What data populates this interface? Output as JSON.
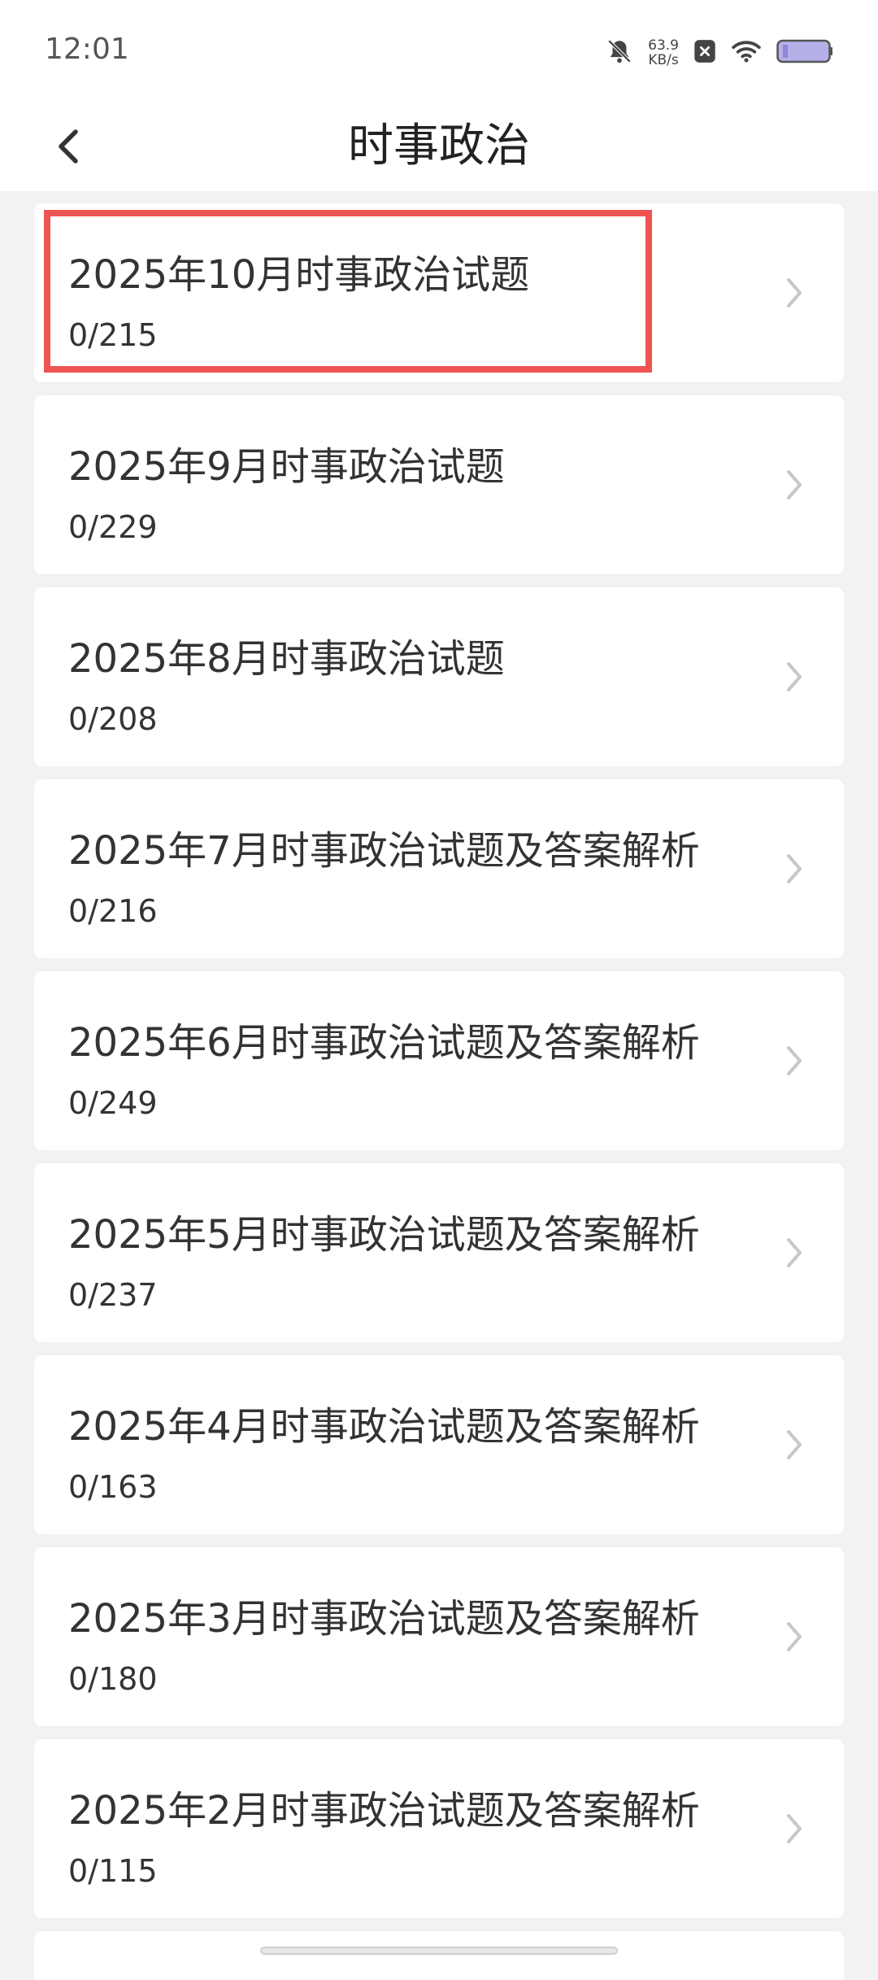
{
  "status_bar": {
    "time": "12:01",
    "net_speed_value": "63.9",
    "net_speed_unit": "KB/s",
    "icons": [
      "bell-off-icon",
      "close-badge-icon",
      "wifi-icon",
      "battery-icon"
    ]
  },
  "header": {
    "title": "时事政治",
    "back_icon": "chevron-left-icon"
  },
  "items": [
    {
      "title": "2025年10月时事政治试题",
      "count": "0/215"
    },
    {
      "title": "2025年9月时事政治试题",
      "count": "0/229"
    },
    {
      "title": "2025年8月时事政治试题",
      "count": "0/208"
    },
    {
      "title": "2025年7月时事政治试题及答案解析",
      "count": "0/216"
    },
    {
      "title": "2025年6月时事政治试题及答案解析",
      "count": "0/249"
    },
    {
      "title": "2025年5月时事政治试题及答案解析",
      "count": "0/237"
    },
    {
      "title": "2025年4月时事政治试题及答案解析",
      "count": "0/163"
    },
    {
      "title": "2025年3月时事政治试题及答案解析",
      "count": "0/180"
    },
    {
      "title": "2025年2月时事政治试题及答案解析",
      "count": "0/115"
    }
  ],
  "colors": {
    "highlight": "#ee5454",
    "background": "#f2f2f2",
    "card": "#ffffff",
    "chevron": "#c8c8c8"
  }
}
